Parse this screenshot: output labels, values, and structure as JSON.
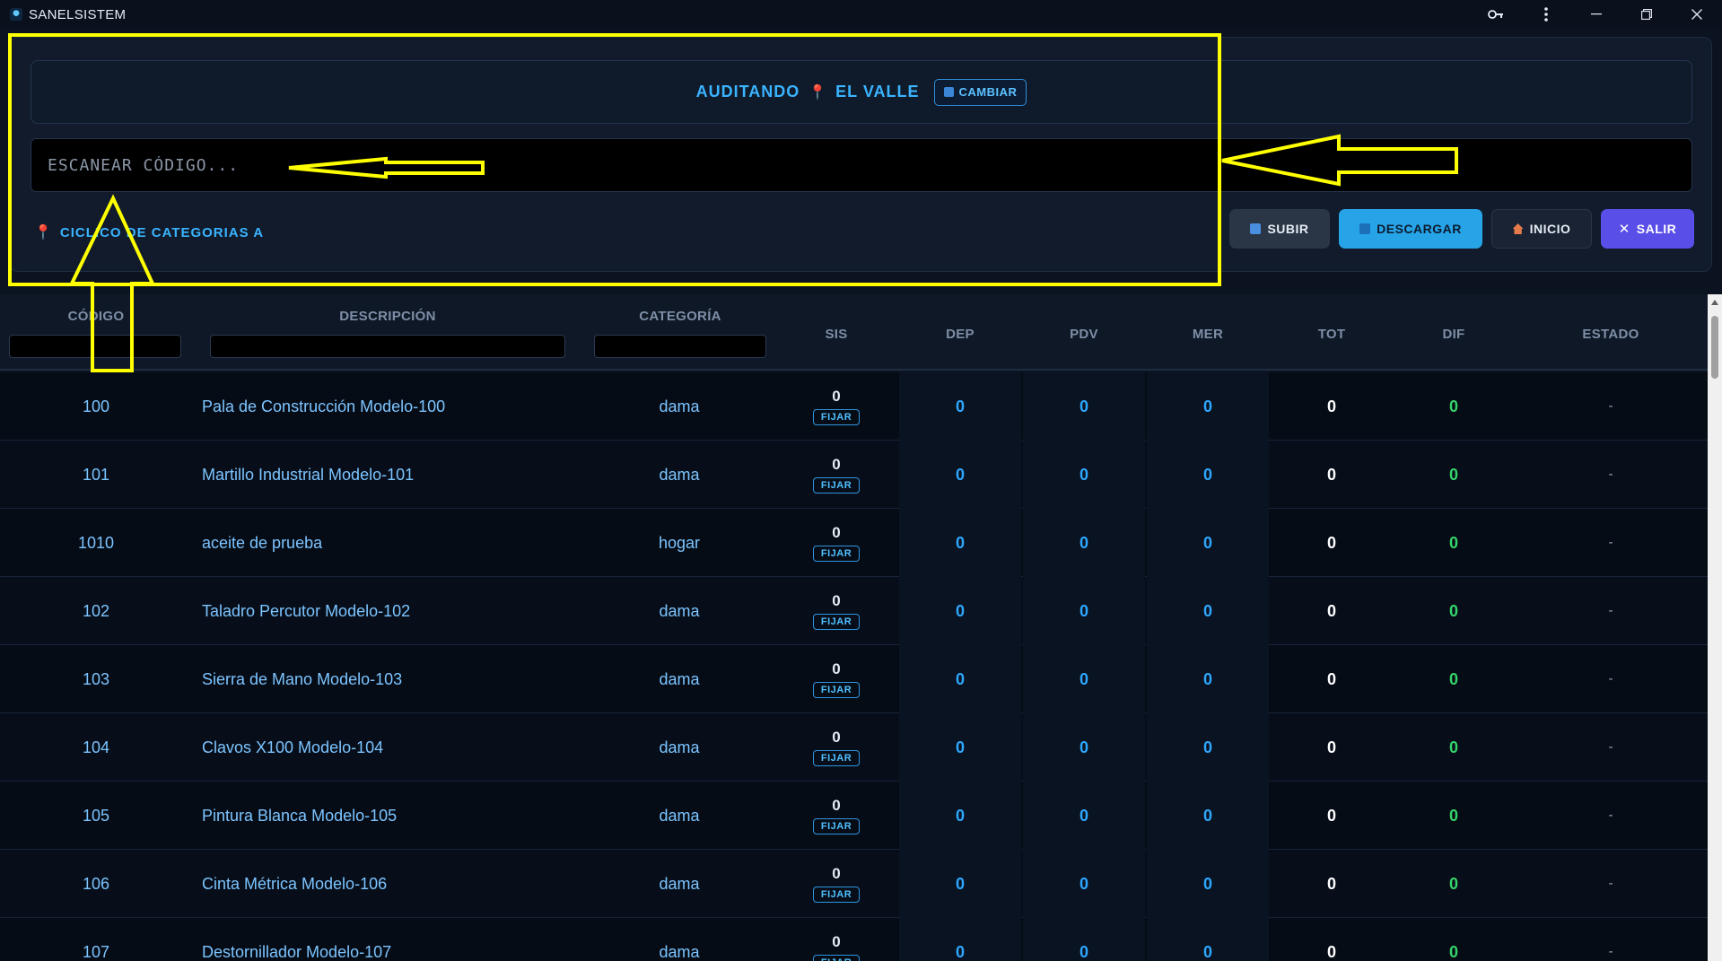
{
  "window": {
    "title": "SANELSISTEM"
  },
  "audit": {
    "label": "AUDITANDO",
    "location": "EL VALLE",
    "change_label": "CAMBIAR"
  },
  "scan": {
    "placeholder": "ESCANEAR CÓDIGO..."
  },
  "cycle": {
    "label": "CICLICO DE CATEGORIAS A"
  },
  "actions": {
    "subir": "SUBIR",
    "descargar": "DESCARGAR",
    "inicio": "INICIO",
    "salir": "SALIR"
  },
  "table": {
    "headers": {
      "codigo": "CÓDIGO",
      "descripcion": "DESCRIPCIÓN",
      "categoria": "CATEGORÍA",
      "sis": "SIS",
      "dep": "DEP",
      "pdv": "PDV",
      "mer": "MER",
      "tot": "TOT",
      "dif": "DIF",
      "estado": "ESTADO"
    },
    "fix_label": "FIJAR",
    "rows": [
      {
        "code": "100",
        "desc": "Pala de Construcción Modelo-100",
        "cat": "dama",
        "sis": "0",
        "dep": "0",
        "pdv": "0",
        "mer": "0",
        "tot": "0",
        "dif": "0",
        "estado": "-"
      },
      {
        "code": "101",
        "desc": "Martillo Industrial Modelo-101",
        "cat": "dama",
        "sis": "0",
        "dep": "0",
        "pdv": "0",
        "mer": "0",
        "tot": "0",
        "dif": "0",
        "estado": "-"
      },
      {
        "code": "1010",
        "desc": "aceite de prueba",
        "cat": "hogar",
        "sis": "0",
        "dep": "0",
        "pdv": "0",
        "mer": "0",
        "tot": "0",
        "dif": "0",
        "estado": "-"
      },
      {
        "code": "102",
        "desc": "Taladro Percutor Modelo-102",
        "cat": "dama",
        "sis": "0",
        "dep": "0",
        "pdv": "0",
        "mer": "0",
        "tot": "0",
        "dif": "0",
        "estado": "-"
      },
      {
        "code": "103",
        "desc": "Sierra de Mano Modelo-103",
        "cat": "dama",
        "sis": "0",
        "dep": "0",
        "pdv": "0",
        "mer": "0",
        "tot": "0",
        "dif": "0",
        "estado": "-"
      },
      {
        "code": "104",
        "desc": "Clavos X100 Modelo-104",
        "cat": "dama",
        "sis": "0",
        "dep": "0",
        "pdv": "0",
        "mer": "0",
        "tot": "0",
        "dif": "0",
        "estado": "-"
      },
      {
        "code": "105",
        "desc": "Pintura Blanca Modelo-105",
        "cat": "dama",
        "sis": "0",
        "dep": "0",
        "pdv": "0",
        "mer": "0",
        "tot": "0",
        "dif": "0",
        "estado": "-"
      },
      {
        "code": "106",
        "desc": "Cinta Métrica Modelo-106",
        "cat": "dama",
        "sis": "0",
        "dep": "0",
        "pdv": "0",
        "mer": "0",
        "tot": "0",
        "dif": "0",
        "estado": "-"
      },
      {
        "code": "107",
        "desc": "Destornillador Modelo-107",
        "cat": "dama",
        "sis": "0",
        "dep": "0",
        "pdv": "0",
        "mer": "0",
        "tot": "0",
        "dif": "0",
        "estado": "-"
      }
    ]
  },
  "colors": {
    "accent": "#3ab4ff",
    "annotation": "#ffff00",
    "diff_ok": "#35d46a",
    "salir": "#5a4ee8"
  }
}
